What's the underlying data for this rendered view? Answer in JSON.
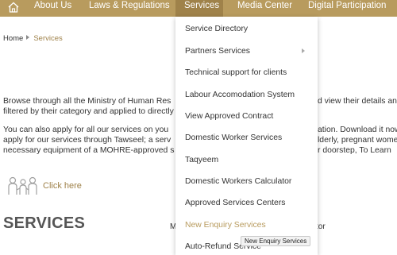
{
  "nav": {
    "home_icon": "home-icon",
    "items": [
      "About Us",
      "Laws & Regulations",
      "Services",
      "Media Center",
      "Digital Participation"
    ],
    "active_index": 2
  },
  "breadcrumb": {
    "home": "Home",
    "current": "Services"
  },
  "intro": {
    "line1_left": "Browse through all the Ministry of Human Res",
    "line1_right": "d view their details an",
    "line2": "filtered by their category and applied to directly",
    "line3_left": "You can also apply for all our services on you",
    "line3_right": "ation. Download it now",
    "line4_left": "apply for our services through Tawseel; a serv",
    "line4_right": "lderly, pregnant wome",
    "line5_left": "necessary equipment of a MOHRE-approved s",
    "line5_right": "r doorstep, To Learn"
  },
  "click_here": "Click here",
  "services_heading": "SERVICES",
  "partial_text": {
    "left": "M",
    "right": "tor"
  },
  "dropdown": {
    "items": [
      "Service Directory",
      "Partners Services",
      "Technical support for clients",
      "Labour Accomodation System",
      "View Approved Contract",
      "Domestic Worker Services",
      "Taqyeem",
      "Domestic Workers Calculator",
      "Approved Services Centers",
      "New Enquiry Services",
      "Auto-Refund Service"
    ],
    "hovered_index": 9,
    "submenu_index": 1
  },
  "tooltip": "New Enquiry Services",
  "colors": {
    "nav_bg": "#b89b5e",
    "accent": "#9f824a",
    "hover_text": "#b89b5e"
  }
}
